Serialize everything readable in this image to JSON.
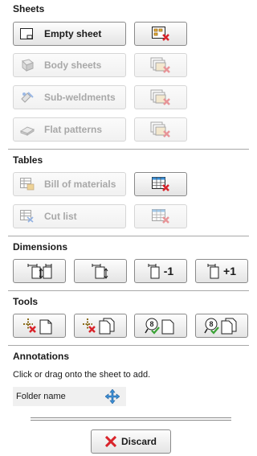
{
  "sections": {
    "sheets": "Sheets",
    "tables": "Tables",
    "dimensions": "Dimensions",
    "tools": "Tools",
    "annotations": "Annotations"
  },
  "sheets": {
    "empty_sheet": "Empty sheet",
    "body_sheets": "Body sheets",
    "sub_weldments": "Sub-weldments",
    "flat_patterns": "Flat patterns"
  },
  "tables": {
    "bill_of_materials": "Bill of materials",
    "cut_list": "Cut list"
  },
  "dimensions": {
    "minus_one": "-1",
    "plus_one": "+1"
  },
  "annotations": {
    "hint": "Click or drag onto the sheet to add.",
    "folder_name": "Folder name"
  },
  "footer": {
    "discard": "Discard"
  },
  "colors": {
    "accent_red": "#d9232a",
    "accent_green": "#3aa335",
    "move_blue": "#3a8fd6"
  }
}
